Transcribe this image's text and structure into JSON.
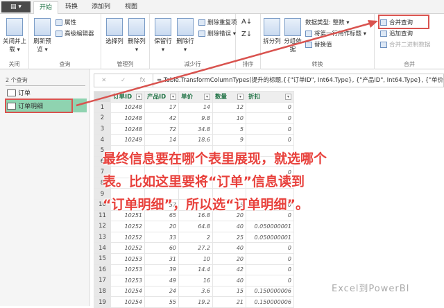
{
  "tabs": {
    "file": "▤ ▾",
    "items": [
      "开始",
      "转换",
      "添加列",
      "视图"
    ]
  },
  "ribbon": {
    "close": {
      "btn": "关闭并上载 ▾",
      "label": "关闭"
    },
    "query": {
      "refresh": "刷新预览 ▾",
      "properties": "属性",
      "advanced": "高级编辑器",
      "label": "查询"
    },
    "manage": {
      "choose": "选择列",
      "remove": "删除列 ▾",
      "label": "管理列"
    },
    "reduce": {
      "keep": "保留行 ▾",
      "remove": "删除行 ▾",
      "dup": "删除重复项",
      "err": "删除错误 ▾",
      "label": "减少行"
    },
    "sort": {
      "label": "排序"
    },
    "transform": {
      "split": "拆分列",
      "group": "分组依据",
      "dtype": "数据类型: 整数 ▾",
      "header": "将第一行用作标题 ▾",
      "replace": "替换值",
      "label": "转换"
    },
    "combine": {
      "merge": "合并查询",
      "append": "追加查询",
      "binary": "合并二进制数据",
      "label": "合并"
    }
  },
  "left": {
    "header": "2 个查询",
    "items": [
      "订单",
      "订单明细"
    ]
  },
  "formula": {
    "cancel": "✕",
    "ok": "✓",
    "fx": "fx",
    "text": "= Table.TransformColumnTypes(提升的标题,{{\"订单ID\", Int64.Type}, {\"产品ID\", Int64.Type}, {\"单价\""
  },
  "table": {
    "columns": [
      "订单ID",
      "产品ID",
      "单价",
      "数量",
      "折扣"
    ],
    "rows": [
      [
        "1",
        "10248",
        "17",
        "14",
        "12",
        "0"
      ],
      [
        "2",
        "10248",
        "42",
        "9.8",
        "10",
        "0"
      ],
      [
        "3",
        "10248",
        "72",
        "34.8",
        "5",
        "0"
      ],
      [
        "4",
        "10249",
        "14",
        "18.6",
        "9",
        "0"
      ],
      [
        "5",
        "",
        "",
        "",
        "",
        ""
      ],
      [
        "6",
        "",
        "",
        "",
        "",
        ""
      ],
      [
        "7",
        "",
        "",
        "",
        "",
        "0"
      ],
      [
        "8",
        "",
        "",
        "",
        "",
        "0"
      ],
      [
        "9",
        "",
        "",
        "",
        "",
        ""
      ],
      [
        "10",
        "10251",
        "57",
        "",
        "15",
        "0"
      ],
      [
        "11",
        "10251",
        "65",
        "16.8",
        "20",
        "0"
      ],
      [
        "12",
        "10252",
        "20",
        "64.8",
        "40",
        "0.050000001"
      ],
      [
        "13",
        "10252",
        "33",
        "2",
        "25",
        "0.050000001"
      ],
      [
        "14",
        "10252",
        "60",
        "27.2",
        "40",
        "0"
      ],
      [
        "15",
        "10253",
        "31",
        "10",
        "20",
        "0"
      ],
      [
        "16",
        "10253",
        "39",
        "14.4",
        "42",
        "0"
      ],
      [
        "17",
        "10253",
        "49",
        "16",
        "40",
        "0"
      ],
      [
        "18",
        "10254",
        "24",
        "3.6",
        "15",
        "0.150000006"
      ],
      [
        "19",
        "10254",
        "55",
        "19.2",
        "21",
        "0.150000006"
      ]
    ]
  },
  "overlay": {
    "line1": "最终信息要在哪个表里展现，就选哪个",
    "line2": "表。比如这里要将“订单”信息读到",
    "line3": "“订单明细”，所以选“订单明细”。"
  },
  "watermark": "Excel到PowerBI",
  "colors": {
    "accent": "#217346",
    "highlight": "#d9534f",
    "selected": "#8fd3b0"
  }
}
